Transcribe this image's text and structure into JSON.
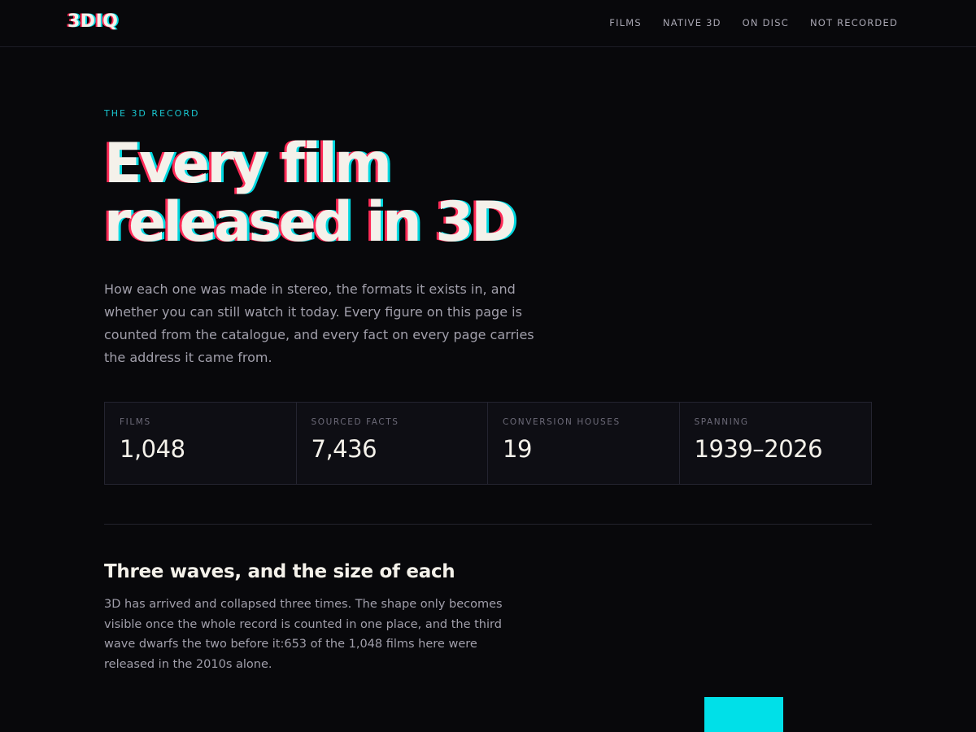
{
  "brand": {
    "logo": "3DIQ"
  },
  "nav": {
    "items": [
      "FILMS",
      "NATIVE 3D",
      "ON DISC",
      "NOT RECORDED"
    ]
  },
  "hero": {
    "eyebrow": "THE 3D RECORD",
    "title_line1": "Every film",
    "title_line2": "released in 3D",
    "lead": "How each one was made in stereo, the formats it exists in, and whether you can still watch it today. Every figure on this page is counted from the catalogue, and every fact on every page carries the address it came from."
  },
  "stats": [
    {
      "label": "FILMS",
      "value": "1,048"
    },
    {
      "label": "SOURCED FACTS",
      "value": "7,436"
    },
    {
      "label": "CONVERSION HOUSES",
      "value": "19"
    },
    {
      "label": "SPANNING",
      "value": "1939–2026"
    }
  ],
  "waves": {
    "title": "Three waves, and the size of each",
    "body": "3D has arrived and collapsed three times. The shape only becomes visible once the whole record is counted in one place, and the third wave dwarfs the two before it:653 of the 1,048 films here were released in the 2010s alone."
  },
  "colors": {
    "background": "#08080b",
    "accent_cyan": "#00d8e0",
    "accent_red": "#ff2b57",
    "text": "#f4f1ea"
  }
}
